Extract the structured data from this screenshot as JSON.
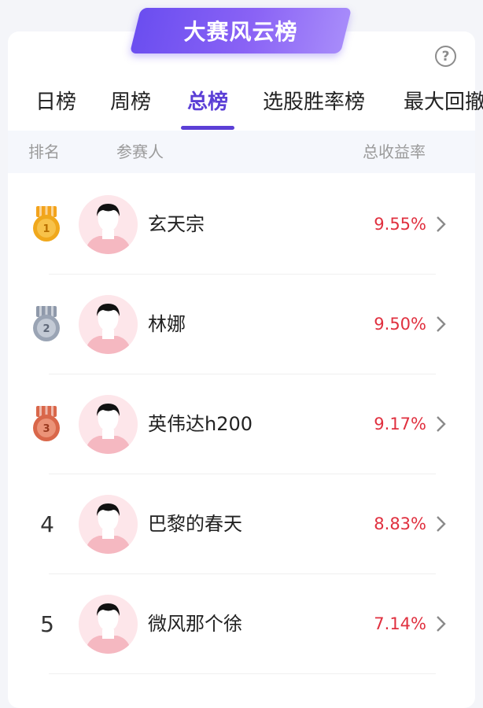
{
  "banner": {
    "title": "大赛风云榜"
  },
  "help": {
    "label": "?"
  },
  "tabs": [
    {
      "label": "日榜"
    },
    {
      "label": "周榜"
    },
    {
      "label": "总榜"
    },
    {
      "label": "选股胜率榜"
    },
    {
      "label": "最大回撤"
    }
  ],
  "active_tab": "总榜",
  "header": {
    "rank": "排名",
    "participant": "参赛人",
    "return": "总收益率"
  },
  "rows": [
    {
      "rank": "1",
      "medal": "gold",
      "name": "玄天宗",
      "rate": "9.55%"
    },
    {
      "rank": "2",
      "medal": "silver",
      "name": "林娜",
      "rate": "9.50%"
    },
    {
      "rank": "3",
      "medal": "bronze",
      "name": "英伟达h200",
      "rate": "9.17%"
    },
    {
      "rank": "4",
      "medal": "",
      "name": "巴黎的春天",
      "rate": "8.83%"
    },
    {
      "rank": "5",
      "medal": "",
      "name": "微风那个徐",
      "rate": "7.14%"
    }
  ],
  "colors": {
    "accent": "#5b3fd6",
    "positive": "#e0303f",
    "gold": "#f0a81c",
    "silver": "#9aa4b4",
    "bronze": "#d9674a"
  }
}
